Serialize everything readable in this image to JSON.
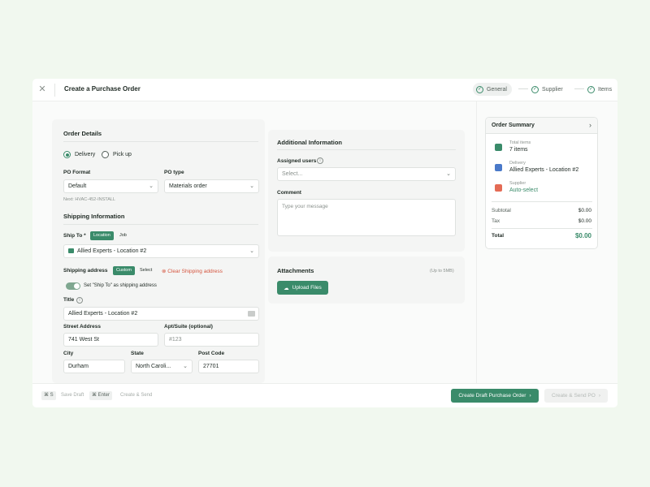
{
  "header": {
    "title": "Create a Purchase Order",
    "steps": [
      {
        "label": "General",
        "state": "active"
      },
      {
        "label": "Supplier",
        "state": "done"
      },
      {
        "label": "Items",
        "state": "done"
      }
    ]
  },
  "order_details": {
    "title": "Order Details",
    "delivery_label": "Delivery",
    "pickup_label": "Pick up",
    "selected_method": "Delivery",
    "po_format_label": "PO Format",
    "po_format_value": "Default",
    "po_type_label": "PO type",
    "po_type_value": "Materials order",
    "next_number": "Next: HVAC-452-INSTALL"
  },
  "shipping": {
    "title": "Shipping Information",
    "ship_to_label": "Ship To *",
    "ship_to_options": [
      "Location",
      "Job"
    ],
    "ship_to_selected": "Location",
    "location_value": "Allied Experts - Location #2",
    "shipping_address_label": "Shipping address",
    "address_options": [
      "Custom",
      "Select"
    ],
    "address_selected": "Custom",
    "clear_label": "Clear Shipping address",
    "toggle_label": "Set \"Ship To\" as shipping address",
    "toggle_on": true,
    "title_label": "Title",
    "title_value": "Allied Experts - Location #2",
    "street_label": "Street Address",
    "street_value": "741 West St",
    "apt_label": "Apt/Suite (optional)",
    "apt_placeholder": "#123",
    "city_label": "City",
    "city_value": "Durham",
    "state_label": "State",
    "state_value": "North Caroli...",
    "post_label": "Post Code",
    "post_value": "27701"
  },
  "additional": {
    "title": "Additional Information",
    "assigned_label": "Assigned users",
    "assigned_placeholder": "Select...",
    "comment_label": "Comment",
    "comment_placeholder": "Type your message"
  },
  "attachments": {
    "title": "Attachments",
    "limit": "(Up to 5MB)",
    "upload_label": "Upload Files"
  },
  "summary": {
    "title": "Order Summary",
    "total_items_label": "Total items",
    "total_items_value": "7 items",
    "delivery_label": "Delivery",
    "delivery_value": "Allied Experts - Location #2",
    "supplier_label": "Supplier",
    "supplier_value": "Auto-select",
    "subtotal_label": "Subtotal",
    "subtotal_value": "$0.00",
    "tax_label": "Tax",
    "tax_value": "$0.00",
    "total_label": "Total",
    "total_value": "$0.00"
  },
  "footer": {
    "shortcut1_key": "⌘   S",
    "shortcut1_label": "Save Draft",
    "shortcut2_key": "⌘   Enter",
    "shortcut2_label": "Create & Send",
    "primary_label": "Create Draft Purchase Order",
    "secondary_label": "Create & Send PO"
  },
  "colors": {
    "background": "#f1f8ef",
    "accent": "#3a8b6a",
    "danger": "#d5553f"
  }
}
